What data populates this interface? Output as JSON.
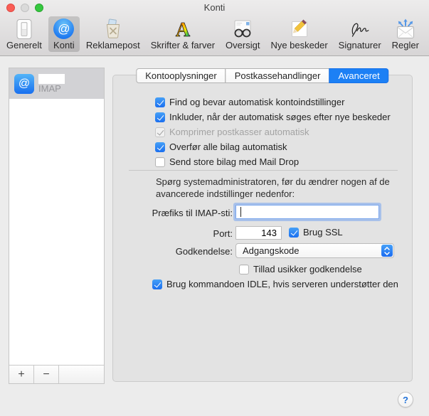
{
  "window": {
    "title": "Konti"
  },
  "colors": {
    "accent_blue": "#1c80f5",
    "window_bg": "#ececec",
    "panel_bg": "#e3e3e3",
    "selected_row_bg": "#d2d2d5",
    "traffic_red": "#fa5d55",
    "traffic_gray": "#dadada",
    "traffic_green": "#35c83f"
  },
  "toolbar": {
    "items": [
      {
        "label": "Generelt",
        "icon": "switch-icon",
        "selected": false
      },
      {
        "label": "Konti",
        "icon": "at-circle-icon",
        "selected": true
      },
      {
        "label": "Reklamepost",
        "icon": "junk-basket-icon",
        "selected": false
      },
      {
        "label": "Skrifter & farver",
        "icon": "letter-a-icon",
        "selected": false
      },
      {
        "label": "Oversigt",
        "icon": "glasses-icon",
        "selected": false
      },
      {
        "label": "Nye beskeder",
        "icon": "pencil-icon",
        "selected": false
      },
      {
        "label": "Signaturer",
        "icon": "signature-icon",
        "selected": false
      },
      {
        "label": "Regler",
        "icon": "envelope-arrows-icon",
        "selected": false
      }
    ]
  },
  "sidebar": {
    "account": {
      "type_label": "IMAP",
      "icon": "at-square-icon",
      "name_redacted": true,
      "selected": true
    },
    "buttons": {
      "add": "+",
      "remove": "−"
    }
  },
  "tabs": [
    {
      "label": "Kontooplysninger",
      "selected": false
    },
    {
      "label": "Postkassehandlinger",
      "selected": false
    },
    {
      "label": "Avanceret",
      "selected": true
    }
  ],
  "panel": {
    "checkboxes": [
      {
        "label": "Find og bevar automatisk kontoindstillinger",
        "checked": true,
        "enabled": true
      },
      {
        "label": "Inkluder, når der automatisk søges efter nye beskeder",
        "checked": true,
        "enabled": true
      },
      {
        "label": "Komprimer postkasser automatisk",
        "checked": true,
        "enabled": false
      },
      {
        "label": "Overfør alle bilag automatisk",
        "checked": true,
        "enabled": true
      },
      {
        "label": "Send store bilag med Mail Drop",
        "checked": false,
        "enabled": true
      }
    ],
    "admin_note": {
      "line1": "Spørg systemadministratoren, før du ændrer nogen af de",
      "line2": "avancerede indstillinger nedenfor:"
    },
    "fields": {
      "prefix_label": "Præfiks til IMAP-sti:",
      "prefix_value": "",
      "port_label": "Port:",
      "port_value": "143",
      "ssl_label": "Brug SSL",
      "ssl_checked": true,
      "auth_label": "Godkendelse:",
      "auth_value": "Adgangskode",
      "insecure_label": "Tillad usikker godkendelse",
      "insecure_checked": false,
      "idle_label": "Brug kommandoen IDLE, hvis serveren understøtter den",
      "idle_checked": true
    }
  },
  "help": {
    "label": "?"
  }
}
